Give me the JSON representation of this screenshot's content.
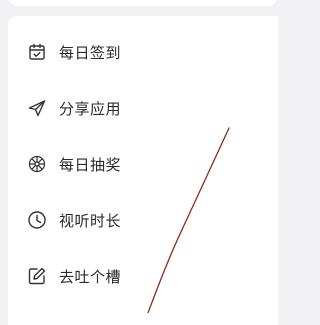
{
  "menu": {
    "items": [
      {
        "label": "每日签到",
        "icon": "calendar-check-icon"
      },
      {
        "label": "分享应用",
        "icon": "share-plane-icon"
      },
      {
        "label": "每日抽奖",
        "icon": "lottery-wheel-icon"
      },
      {
        "label": "视听时长",
        "icon": "clock-icon"
      },
      {
        "label": "去吐个槽",
        "icon": "feedback-edit-icon"
      }
    ]
  },
  "colors": {
    "background": "#f2f2f4",
    "card": "#ffffff",
    "text": "#2a2a2a",
    "icon": "#333333",
    "annotation_stroke": "#8b2a1a"
  }
}
